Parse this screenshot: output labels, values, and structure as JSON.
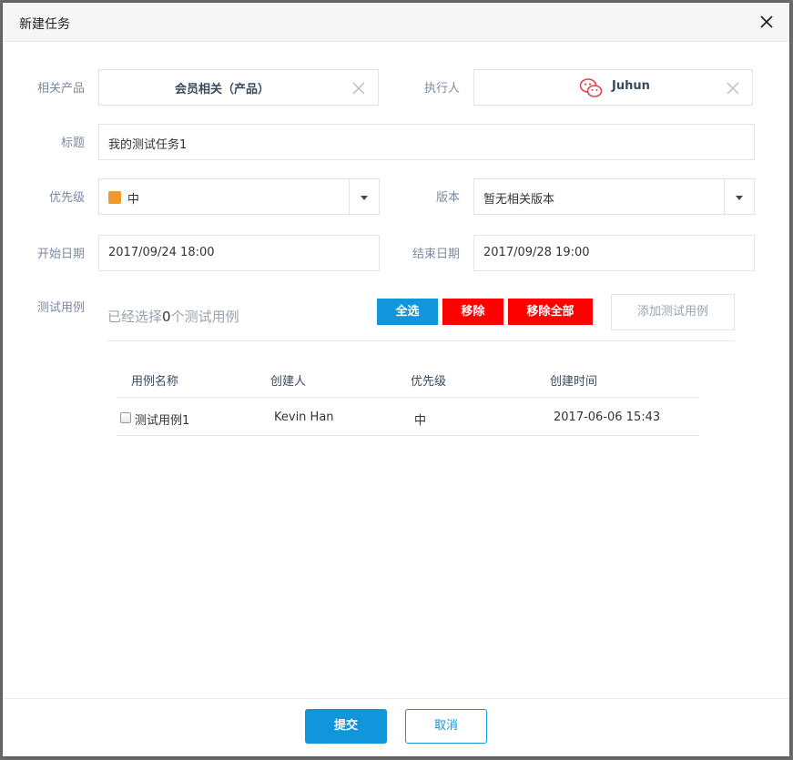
{
  "dialog": {
    "title": "新建任务"
  },
  "form": {
    "product": {
      "label": "相关产品",
      "value": "会员相关（产品）"
    },
    "executor": {
      "label": "执行人",
      "value": "Juhun",
      "icon": "wechat-icon"
    },
    "title": {
      "label": "标题",
      "value": "我的测试任务1"
    },
    "priority": {
      "label": "优先级",
      "value": "中",
      "color": "#f19a26"
    },
    "version": {
      "label": "版本",
      "value": "暂无相关版本"
    },
    "start_date": {
      "label": "开始日期",
      "value": "2017/09/24 18:00"
    },
    "end_date": {
      "label": "结束日期",
      "value": "2017/09/28 19:00"
    },
    "cases": {
      "label": "测试用例",
      "selected_prefix": "已经选择",
      "selected_count": "0",
      "selected_suffix": "个测试用例",
      "buttons": {
        "select_all": "全选",
        "remove": "移除",
        "remove_all": "移除全部",
        "add": "添加测试用例"
      },
      "columns": [
        "用例名称",
        "创建人",
        "优先级",
        "创建时间"
      ],
      "rows": [
        {
          "name": "测试用例1",
          "creator": "Kevin Han",
          "priority": "中",
          "created": "2017-06-06 15:43"
        }
      ]
    }
  },
  "footer": {
    "submit": "提交",
    "cancel": "取消"
  },
  "colors": {
    "primary": "#1296db",
    "danger": "#ff0000",
    "accent_orange": "#f19a26",
    "wechat_red": "#e5414f"
  }
}
